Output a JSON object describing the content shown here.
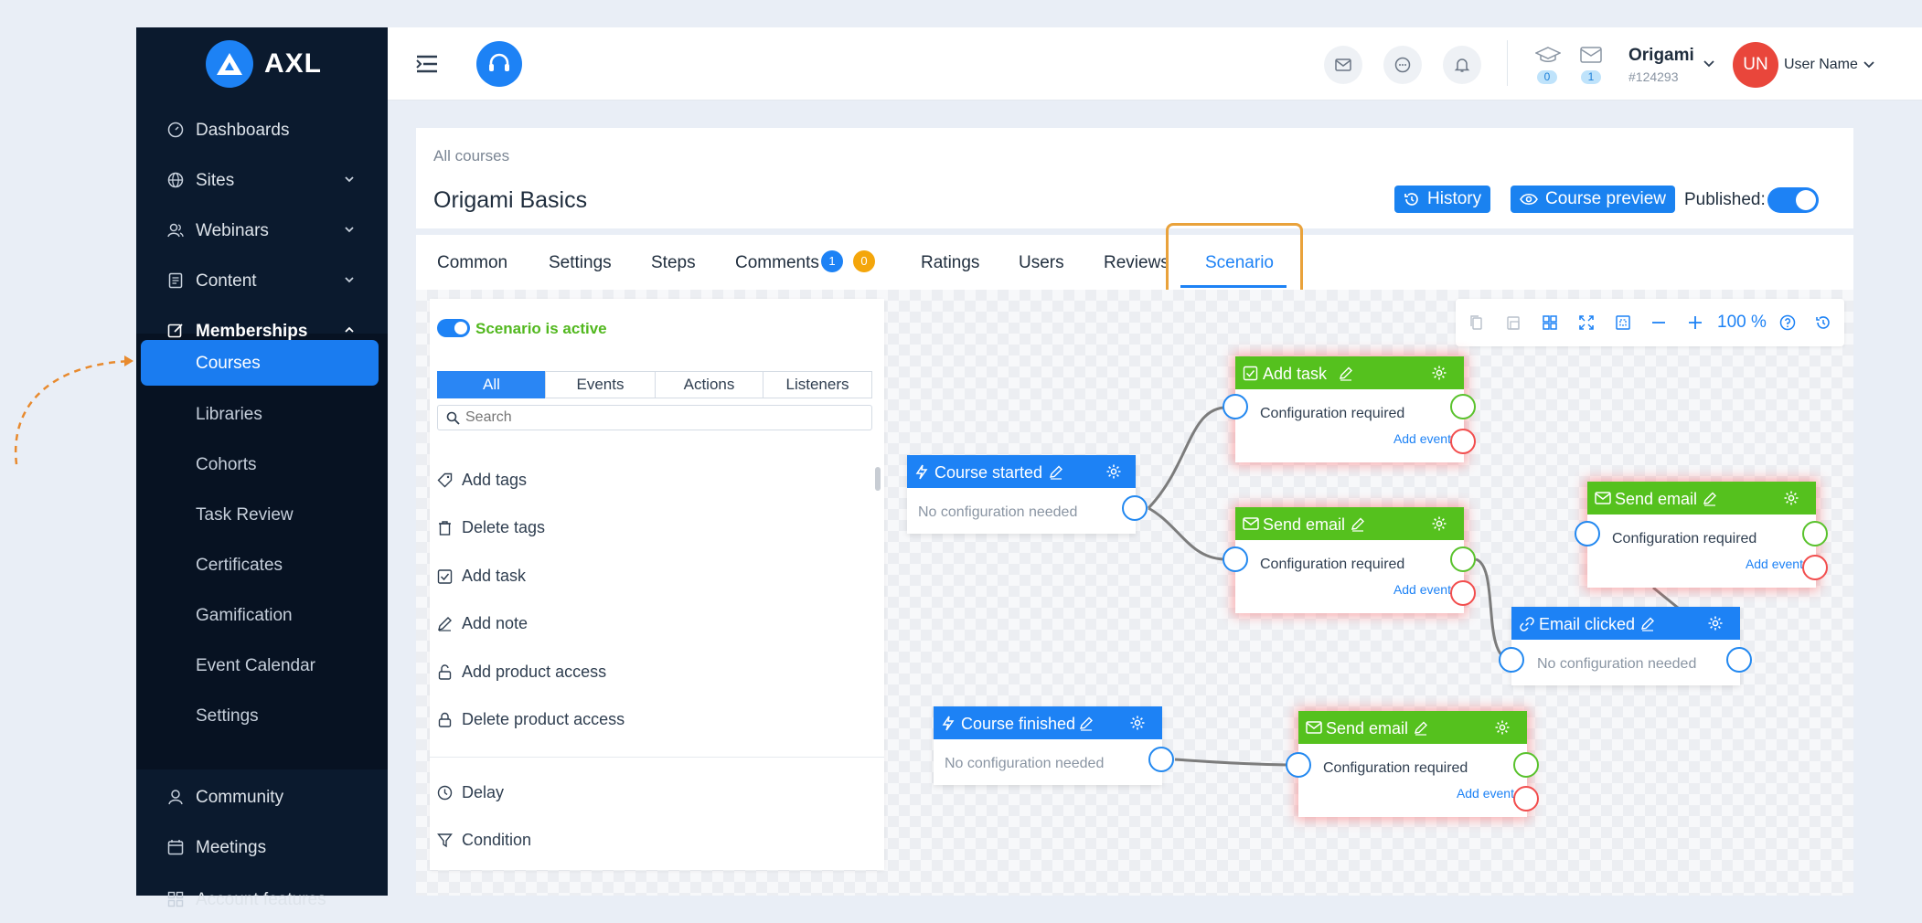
{
  "app": {
    "name": "AXL",
    "brand_color": "#1d82f5"
  },
  "sidebar": {
    "items_top": [
      {
        "label": "Dashboards",
        "icon": "gauge-icon"
      },
      {
        "label": "Sites",
        "icon": "globe-icon"
      },
      {
        "label": "Webinars",
        "icon": "users-icon"
      },
      {
        "label": "Content",
        "icon": "document-icon"
      },
      {
        "label": "Memberships",
        "icon": "edit-icon"
      }
    ],
    "sub_items": [
      "Courses",
      "Libraries",
      "Cohorts",
      "Task Review",
      "Certificates",
      "Gamification",
      "Event Calendar",
      "Settings"
    ],
    "active_sub": "Courses",
    "items_bottom": [
      {
        "label": "Community",
        "icon": "user-icon"
      },
      {
        "label": "Meetings",
        "icon": "calendar-icon"
      },
      {
        "label": "Account features",
        "icon": "grid-icon"
      }
    ]
  },
  "header": {
    "counts": [
      "0",
      "1"
    ],
    "account": {
      "name": "Origami",
      "id": "#124293"
    },
    "user": {
      "initials": "UN",
      "name": "User Name",
      "avatar_color": "#e9463b"
    }
  },
  "course": {
    "breadcrumb": "All courses",
    "title": "Origami Basics",
    "history_label": "History",
    "preview_label": "Course preview",
    "published_label": "Published:",
    "published": true
  },
  "tabs": {
    "items": [
      "Common",
      "Settings",
      "Steps",
      "Comments",
      "Ratings",
      "Users",
      "Reviews",
      "Scenario"
    ],
    "active": "Scenario",
    "comment_badges": [
      "1",
      "0"
    ],
    "highlight_color": "#e9a23b"
  },
  "panel": {
    "active_label": "Scenario is active",
    "filters": [
      "All",
      "Events",
      "Actions",
      "Listeners"
    ],
    "search_placeholder": "Search",
    "actions": [
      "Add tags",
      "Delete tags",
      "Add task",
      "Add note",
      "Add product access",
      "Delete product access"
    ],
    "logic": [
      "Delay",
      "Condition"
    ]
  },
  "toolbar": {
    "zoom": "100 %"
  },
  "nodes": {
    "course_started": {
      "title": "Course started",
      "body": "No configuration needed"
    },
    "add_task": {
      "title": "Add task",
      "body": "Configuration required",
      "add_event": "Add event"
    },
    "send_email_1": {
      "title": "Send email",
      "body": "Configuration required",
      "add_event": "Add event"
    },
    "send_email_2": {
      "title": "Send email",
      "body": "Configuration required",
      "add_event": "Add event"
    },
    "email_clicked": {
      "title": "Email clicked",
      "body": "No configuration needed"
    },
    "course_finished": {
      "title": "Course finished",
      "body": "No configuration needed"
    },
    "send_email_3": {
      "title": "Send email",
      "body": "Configuration required",
      "add_event": "Add event"
    }
  },
  "colors": {
    "event": "#1d82f5",
    "action": "#55c11e",
    "error_glow": "#ff5050",
    "pointer_arrow": "#e88a2e"
  }
}
